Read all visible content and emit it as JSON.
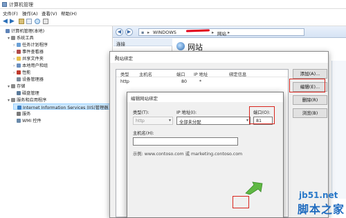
{
  "window": {
    "title": "计算机管理"
  },
  "menu": [
    "文件(F)",
    "操作(A)",
    "查看(V)",
    "帮助(H)"
  ],
  "tree": [
    {
      "label": "计算机管理(本地)",
      "indent": 0,
      "chev": "",
      "icon": "computer-icon",
      "color": "#5f84b8"
    },
    {
      "label": "系统工具",
      "indent": 1,
      "chev": "▾",
      "icon": "tools-icon",
      "color": "#8a8a8a"
    },
    {
      "label": "任务计划程序",
      "indent": 2,
      "chev": "›",
      "icon": "clock-icon",
      "color": "#6aa0d6"
    },
    {
      "label": "事件查看器",
      "indent": 2,
      "chev": "›",
      "icon": "event-icon",
      "color": "#b04a4a"
    },
    {
      "label": "共享文件夹",
      "indent": 2,
      "chev": "›",
      "icon": "folder-icon",
      "color": "#e8c04a"
    },
    {
      "label": "本地用户和组",
      "indent": 2,
      "chev": "›",
      "icon": "users-icon",
      "color": "#6b8fbf"
    },
    {
      "label": "性能",
      "indent": 2,
      "chev": "›",
      "icon": "performance-icon",
      "color": "#c0392b"
    },
    {
      "label": "设备管理器",
      "indent": 2,
      "chev": "",
      "icon": "device-icon",
      "color": "#7a8a9a"
    },
    {
      "label": "存储",
      "indent": 1,
      "chev": "▾",
      "icon": "storage-icon",
      "color": "#8a8a8a"
    },
    {
      "label": "磁盘管理",
      "indent": 2,
      "chev": "",
      "icon": "disk-icon",
      "color": "#5a7a9a"
    },
    {
      "label": "服务和应用程序",
      "indent": 1,
      "chev": "▾",
      "icon": "services-icon",
      "color": "#8a8a8a"
    },
    {
      "label": "Internet Information Services (IIS)管理器",
      "indent": 2,
      "chev": "",
      "icon": "iis-icon",
      "color": "#3b7fc4",
      "selected": true
    },
    {
      "label": "服务",
      "indent": 2,
      "chev": "",
      "icon": "gear-icon",
      "color": "#7a7a7a"
    },
    {
      "label": "WMI 控件",
      "indent": 2,
      "chev": "",
      "icon": "wmi-icon",
      "color": "#6a8aaa"
    }
  ],
  "address": {
    "root": "WINDOWS",
    "crumb": "网站"
  },
  "iis": {
    "connections": "连接",
    "site_heading": "网站"
  },
  "bindings_dialog": {
    "title": "网站绑定",
    "columns": [
      "类型",
      "主机名",
      "端口",
      "IP 地址",
      "绑定信息"
    ],
    "row": {
      "type": "http",
      "host": "",
      "port": "80",
      "ip": "*",
      "info": ""
    },
    "buttons": {
      "add": "添加(A)...",
      "edit": "编辑(E)...",
      "remove": "删除(R)",
      "browse": "浏览(B)"
    }
  },
  "edit_dialog": {
    "title": "编辑网站绑定",
    "type_label": "类型(T):",
    "type_value": "http",
    "ip_label": "IP 地址(I):",
    "ip_value": "全部未分配",
    "port_label": "端口(O):",
    "port_value": "81",
    "host_label": "主机名(H):",
    "host_value": "",
    "example": "示例: www.contoso.com 或 marketing.contoso.com"
  },
  "watermark": {
    "domain": "jb51.net",
    "name": "脚本之家"
  },
  "colors": {
    "highlight": "#d9251d",
    "accent": "#2a6fb8"
  }
}
